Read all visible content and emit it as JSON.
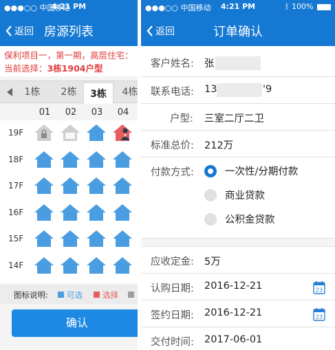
{
  "colors": {
    "primary": "#1578d3",
    "accent_red": "#e23a3a",
    "house_blue": "#4a9de0",
    "house_gray": "#cfcfcf",
    "house_red": "#e85d5d"
  },
  "left": {
    "status": {
      "carrier": "●●●○○ 中国移动",
      "time": "4:21 PM"
    },
    "nav": {
      "back": "返回",
      "title": "房源列表"
    },
    "project": {
      "line1": "保利项目一，第一期，高层住宅：",
      "current_label": "当前选择：",
      "current_value": "3栋1904户型"
    },
    "buildings": {
      "tabs": [
        "1栋",
        "2栋",
        "3栋",
        "4栋"
      ],
      "active": "3栋"
    },
    "units": [
      "01",
      "02",
      "03",
      "04"
    ],
    "floors": [
      {
        "label": "19F",
        "states": [
          "locked",
          "sold",
          "available",
          "selected"
        ]
      },
      {
        "label": "18F",
        "states": [
          "available",
          "available",
          "available",
          "available"
        ]
      },
      {
        "label": "17F",
        "states": [
          "available",
          "available",
          "available",
          "available"
        ]
      },
      {
        "label": "16F",
        "states": [
          "available",
          "available",
          "available",
          "available"
        ]
      },
      {
        "label": "15F",
        "states": [
          "available",
          "available",
          "available",
          "available"
        ]
      },
      {
        "label": "14F",
        "states": [
          "available",
          "available",
          "available",
          "available"
        ]
      }
    ],
    "legend": {
      "title": "图标说明:",
      "available": "可选",
      "selected": "选择"
    },
    "confirm": "确认"
  },
  "right": {
    "status": {
      "carrier": "●●●○○ 中国移动",
      "time": "4:21 PM",
      "battery": "100%"
    },
    "nav": {
      "back": "返回",
      "title": "订单确认"
    },
    "customer": {
      "label": "客户姓名:",
      "value": "张"
    },
    "phone": {
      "label": "联系电话:",
      "prefix": "13",
      "suffix": "'9"
    },
    "layout": {
      "label": "户型:",
      "value": "三室二厅二卫"
    },
    "total": {
      "label": "标准总价:",
      "value": "212万"
    },
    "payment": {
      "label": "付款方式:",
      "options": [
        "一次性/分期付款",
        "商业贷款",
        "公积金贷款"
      ],
      "selected": "一次性/分期付款"
    },
    "deposit": {
      "label": "应收定金:",
      "value": "5万"
    },
    "sub_date": {
      "label": "认购日期:",
      "value": "2016-12-21"
    },
    "sign_date": {
      "label": "签约日期:",
      "value": "2016-12-21"
    },
    "deliver": {
      "label": "交付时间:",
      "value": "2017-06-01"
    },
    "calendar_day": "23"
  }
}
